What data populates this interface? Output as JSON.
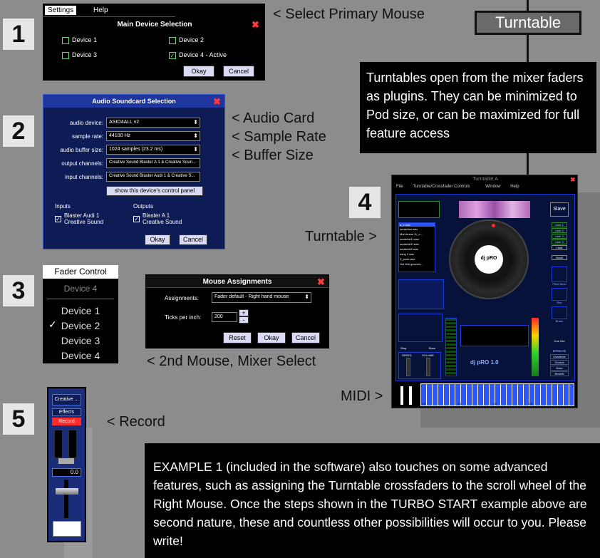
{
  "step1": {
    "num": "1",
    "menu": {
      "settings": "Settings",
      "help": "Help"
    },
    "title": "Main Device Selection",
    "devices": [
      "Device 1",
      "Device 2",
      "Device 3",
      "Device 4 - Active"
    ],
    "okay": "Okay",
    "cancel": "Cancel",
    "annotation": "< Select Primary Mouse"
  },
  "step2": {
    "num": "2",
    "title": "Audio Soundcard Selection",
    "rows": [
      {
        "label": "audio device:",
        "value": "ASIO4ALL v2"
      },
      {
        "label": "sample rate:",
        "value": "44100 Hz"
      },
      {
        "label": "audio buffer size:",
        "value": "1024 samples (23.2 ms)"
      },
      {
        "label": "output channels:",
        "value": "Creative Sound Blaster A 1 & Creative Soun..."
      },
      {
        "label": "input channels:",
        "value": "Creative Sound Blaster Audi 1 & Creative S..."
      }
    ],
    "panel_button": "show this device's control panel",
    "inputs_header": "Inputs",
    "outputs_header": "Outputs",
    "input_item": "Blaster Audi 1 Creative Sound",
    "output_item": "Blaster A 1 Creative Sound",
    "okay": "Okay",
    "cancel": "Cancel",
    "annotations": [
      "<  Audio Card",
      "<  Sample Rate",
      "<  Buffer Size"
    ]
  },
  "step3": {
    "num": "3",
    "fader_control": "Fader Control",
    "fader_items": [
      "Device 4",
      "Device 1",
      "Device 2",
      "Device 3",
      "Device 4"
    ],
    "checked_item": "Device 2",
    "mouse_title": "Mouse Assignments",
    "assignments_label": "Assignments:",
    "assignments_value": "Fader default - Right hand mouse",
    "ticks_label": "Ticks per inch:",
    "ticks_value": "200",
    "reset": "Reset",
    "okay": "Okay",
    "cancel": "Cancel",
    "annotation": "< 2nd Mouse, Mixer Select"
  },
  "step4": {
    "num": "4",
    "badge": "Turntable",
    "info_text": "Turntables open from the mixer faders as plugins. They can be minimized to Pod size, or can be maximized for full feature access",
    "window_title": "Turntable A",
    "menu": [
      "File",
      "Turntable/Crossfader Controls",
      "Window",
      "Help"
    ],
    "slave": "Slave",
    "playlist": [
      "a_1.wav",
      "scratches.wav",
      "Mot drums 11_o...",
      "scratchA1l.wav",
      "scratchA1l.wav",
      "scratchA2.wav",
      "song 1.wav",
      "3_punk.wav",
      "Hot bbb grooves..."
    ],
    "user_buttons": [
      "User 1",
      "User 2",
      "User 3",
      "User 4",
      "Hold"
    ],
    "right_labels": [
      "Scroll",
      "Pitch Bend",
      "Rev",
      "Brake",
      "Cue Out"
    ],
    "effects_header": "EFFECTS",
    "effects": [
      "Overdrive",
      "Chorus",
      "Echo",
      "Reverb"
    ],
    "label_cue_sync": [
      "Stop",
      "Buss"
    ],
    "footer_labels": [
      "SPEED",
      "VOLUME"
    ],
    "center_logo": "dj pRO",
    "logo_text": "dj pRO 1.0",
    "turntable_annotation": "Turntable >",
    "midi_annotation": "MIDI >",
    "piano_labels": [
      "C2",
      "C3",
      "C4",
      "C5"
    ]
  },
  "step5": {
    "num": "5",
    "header": "Creative ...",
    "effects": "Effects",
    "record": "Record",
    "value": "0.0",
    "annotation": "< Record"
  },
  "example_text": "EXAMPLE 1 (included in the software) also touches on some advanced features, such as assigning the Turntable crossfaders to the scroll wheel of the Right Mouse.  Once the steps shown in the TURBO START example above are second nature, these and countless other possibilities will occur to you.  Please write!",
  "colors": {
    "background": "#8c8c8c",
    "dialog_blue": "#0d1c55",
    "record_red": "#ff2a2a",
    "turntable_accent": "#1a3bd6"
  }
}
